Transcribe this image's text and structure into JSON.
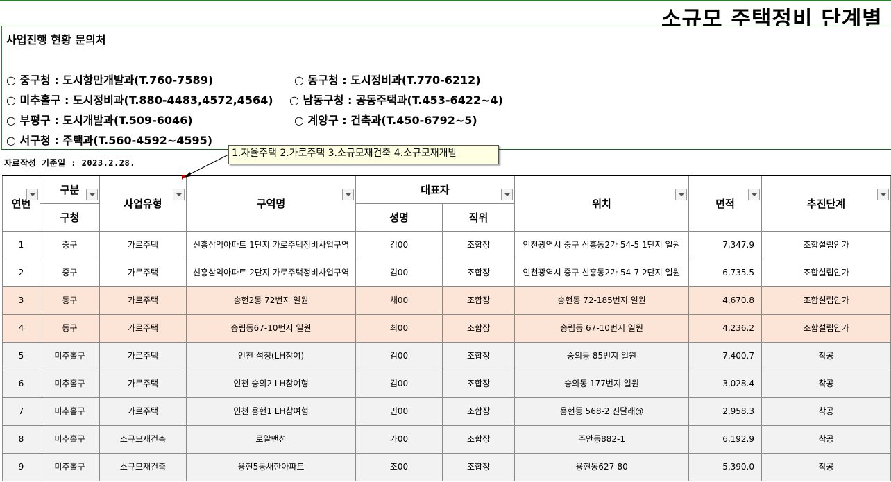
{
  "title": "소규모 주택정비 단계별",
  "contacts": {
    "heading": "사업진행 현황 문의처",
    "items": [
      "○ 중구청 : 도시항만개발과(T.760-7589)",
      "○ 동구청 : 도시정비과(T.770-6212)",
      "○ 미추홀구 : 도시정비과(T.880-4483,4572,4564)",
      "○ 남동구청 : 공동주택과(T.453-6422~4)",
      "○ 부평구 : 도시개발과(T.509-6046)",
      "○ 계양구 : 건축과(T.450-6792~5)",
      "○ 서구청 : 주택과(T.560-4592~4595)"
    ]
  },
  "basis_date": "자료작성 기준일 : 2023.2.28.",
  "tooltip": "1.자율주택 2.가로주택 3.소규모재건축 4.소규모재개발",
  "headers": {
    "no": "연번",
    "category": "구분",
    "district": "구청",
    "project_type": "사업유형",
    "zone_name": "구역명",
    "representative": "대표자",
    "rep_name": "성명",
    "rep_position": "직위",
    "location": "위치",
    "area": "면적",
    "stage": "추진단계"
  },
  "rows": [
    {
      "no": "1",
      "district": "중구",
      "type": "가로주택",
      "zone": "신흥삼익아파트 1단지 가로주택정비사업구역",
      "name": "김00",
      "position": "조합장",
      "location": "인천광역시 중구 신흥동2가 54-5 1단지 일원",
      "area": "7,347.9",
      "stage": "조합설립인가"
    },
    {
      "no": "2",
      "district": "중구",
      "type": "가로주택",
      "zone": "신흥삼익아파트 2단지 가로주택정비사업구역",
      "name": "김00",
      "position": "조합장",
      "location": "인천광역시 중구 신흥동2가 54-7 2단지 일원",
      "area": "6,735.5",
      "stage": "조합설립인가"
    },
    {
      "no": "3",
      "district": "동구",
      "type": "가로주택",
      "zone": "송현2동 72번지 일원",
      "name": "채00",
      "position": "조합장",
      "location": "송현동 72-185번지 일원",
      "area": "4,670.8",
      "stage": "조합설립인가"
    },
    {
      "no": "4",
      "district": "동구",
      "type": "가로주택",
      "zone": "송림동67-10번지 일원",
      "name": "최00",
      "position": "조합장",
      "location": "송림동 67-10번지 일원",
      "area": "4,236.2",
      "stage": "조합설립인가"
    },
    {
      "no": "5",
      "district": "미추홀구",
      "type": "가로주택",
      "zone": "인천 석정(LH참여)",
      "name": "김00",
      "position": "조합장",
      "location": "숭의동 85번지 일원",
      "area": "7,400.7",
      "stage": "착공"
    },
    {
      "no": "6",
      "district": "미추홀구",
      "type": "가로주택",
      "zone": "인천 숭의2 LH참여형",
      "name": "김00",
      "position": "조합장",
      "location": "숭의동 177번지 일원",
      "area": "3,028.4",
      "stage": "착공"
    },
    {
      "no": "7",
      "district": "미추홀구",
      "type": "가로주택",
      "zone": "인천 용현1 LH참여형",
      "name": "민00",
      "position": "조합장",
      "location": "용현동 568-2 진달래@",
      "area": "2,958.3",
      "stage": "착공"
    },
    {
      "no": "8",
      "district": "미추홀구",
      "type": "소규모재건축",
      "zone": "로얄맨션",
      "name": "가00",
      "position": "조합장",
      "location": "주안동882-1",
      "area": "6,192.9",
      "stage": "착공"
    },
    {
      "no": "9",
      "district": "미추홀구",
      "type": "소규모재건축",
      "zone": "용현5동새한아파트",
      "name": "조00",
      "position": "조합장",
      "location": "용현동627-80",
      "area": "5,390.0",
      "stage": "착공"
    }
  ],
  "colors": {
    "title_border": "#2e7d32",
    "peach_row": "#fce4d6",
    "grey_row": "#f2f2f2",
    "tooltip_bg": "#ffffe1",
    "comment_marker": "#d00000"
  }
}
